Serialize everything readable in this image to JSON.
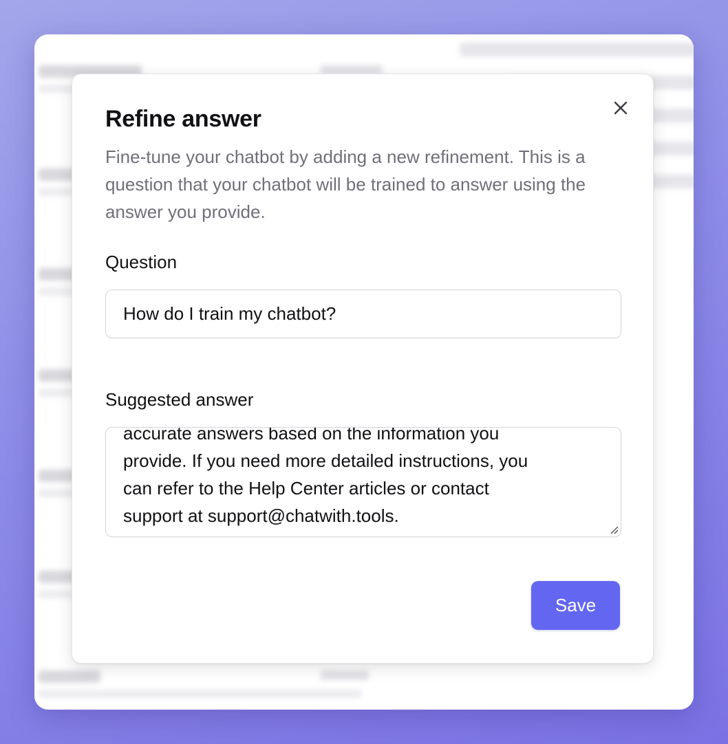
{
  "modal": {
    "title": "Refine answer",
    "description": "Fine-tune your chatbot by adding a new refinement. This is a question that your chatbot will be trained to answer using the answer you provide.",
    "question_label": "Question",
    "question_value": "How do I train my chatbot?",
    "answer_label": "Suggested answer",
    "answer_value": "accurate answers based on the information you\nprovide. If you need more detailed instructions, you\ncan refer to the Help Center articles or contact\nsupport at support@chatwith.tools.",
    "save_label": "Save"
  },
  "icons": {
    "close": "close-icon",
    "resize": "resize-handle-icon"
  },
  "colors": {
    "accent": "#6366f1",
    "background_gradient_start": "#a3a6ea",
    "background_gradient_end": "#7a72e4"
  }
}
